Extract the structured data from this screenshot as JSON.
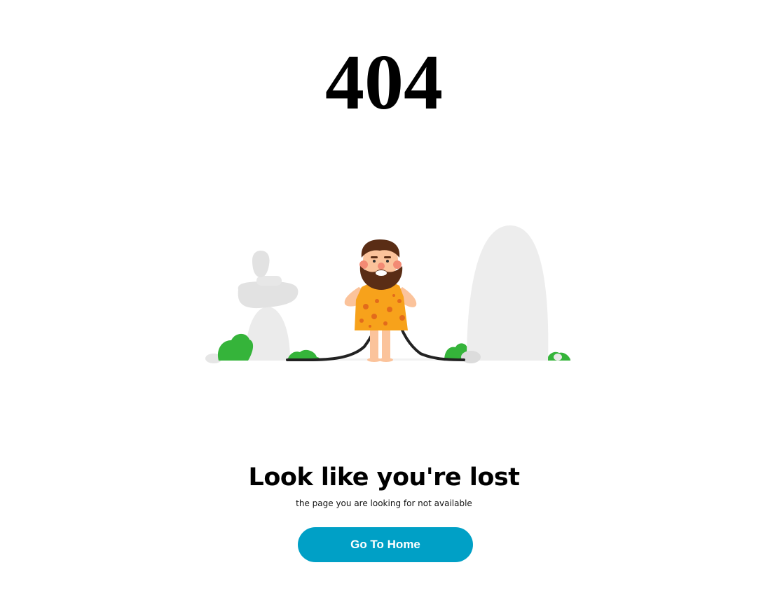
{
  "error": {
    "code": "404"
  },
  "content": {
    "headline": "Look like you're lost",
    "subline": "the page you are looking for not available"
  },
  "actions": {
    "home_button_label": "Go To Home"
  },
  "illustration": {
    "icon": "caveman-404-illustration"
  },
  "colors": {
    "background": "#ffffff",
    "button": "#00a0c6",
    "button_text": "#ffffff",
    "rock": "#ededed",
    "bush": "#35b43a",
    "skin": "#fbc39b",
    "hair": "#5a2d15",
    "tunic": "#f7a21b"
  }
}
